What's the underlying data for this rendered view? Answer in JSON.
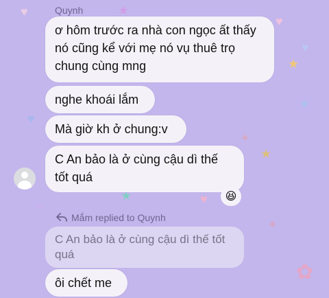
{
  "chat": {
    "sender_name": "Quynh",
    "messages": [
      "ơ hôm trước ra nhà con ngọc ất thấy nó cũng kể với mẹ nó vụ thuê trọ chung cùng mng",
      "nghe khoái lắm",
      "Mà giờ kh ở chung:v",
      "C An bảo là ở cùng cậu dì thế tốt quá"
    ],
    "reaction_emoji": "😆",
    "reply": {
      "label": "Mắm replied to Quynh",
      "quoted_text": "C An bảo là ở cùng cậu dì thế tốt quá",
      "text": "ôi chết me"
    }
  },
  "colors": {
    "wallpaper": "#c3b6ec",
    "bubble": "#f4f2f8",
    "quoted_bubble": "#ddd6f2",
    "meta_text": "#6e6590"
  },
  "icons": [
    "reply-arrow-icon",
    "default-avatar-icon",
    "laughing-emoji"
  ]
}
